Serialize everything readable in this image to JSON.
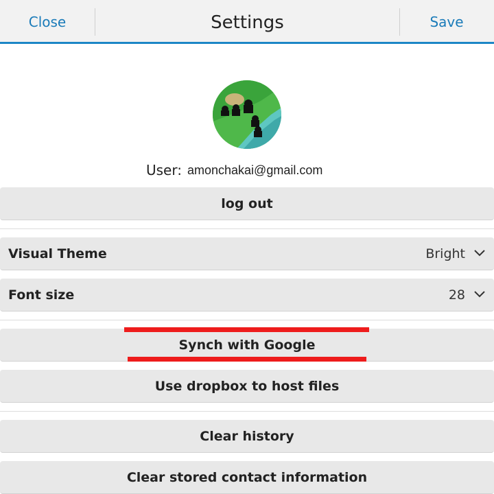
{
  "header": {
    "close_label": "Close",
    "title": "Settings",
    "save_label": "Save",
    "accent_color": "#1c86c6"
  },
  "account": {
    "user_label": "User:",
    "email": "amonchakai@gmail.com",
    "logout_label": "log out"
  },
  "preferences": {
    "visual_theme": {
      "label": "Visual Theme",
      "value": "Bright"
    },
    "font_size": {
      "label": "Font size",
      "value": "28"
    }
  },
  "sync": {
    "google_label": "Synch with Google",
    "dropbox_label": "Use dropbox to host files"
  },
  "data": {
    "clear_history_label": "Clear history",
    "clear_contacts_label": "Clear stored contact information"
  },
  "annotation_color": "#ee1c1c",
  "icons": {
    "chevron": "chevron-down-icon",
    "avatar": "user-avatar"
  }
}
